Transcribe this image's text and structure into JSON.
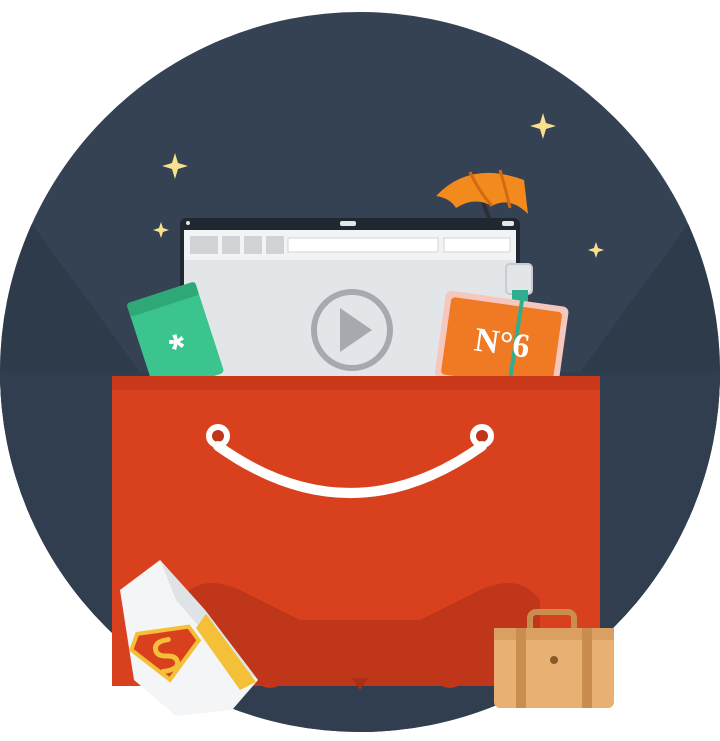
{
  "illustration": {
    "colors": {
      "background_circle": "#344253",
      "background_circle_dark": "#2c3a4a",
      "bag": "#d9411e",
      "bag_shadow": "#c0361a",
      "bag_handle": "#ffffff",
      "browser_frame": "#1f2730",
      "browser_body": "#e3e6e9",
      "browser_toolbar": "#f2f3f4",
      "play_button": "#a6aaae",
      "perfume_bottle": "#f07a24",
      "perfume_cap": "#2fae8f",
      "green_card": "#3cc48e",
      "umbrella": "#f28a1e",
      "suitcase": "#e8b173",
      "suitcase_dark": "#c98e4f",
      "star": "#f8e08e",
      "superhero_badge": "#d9411e",
      "superhero_badge_yellow": "#f3c037"
    },
    "icons": [
      "star-icon",
      "umbrella-icon",
      "browser-window-icon",
      "play-icon",
      "perfume-bottle-icon",
      "green-card-icon",
      "shopping-bag-icon",
      "suitcase-icon",
      "superhero-badge-icon"
    ],
    "perfume_label": "N°6",
    "card_symbol": "*"
  }
}
